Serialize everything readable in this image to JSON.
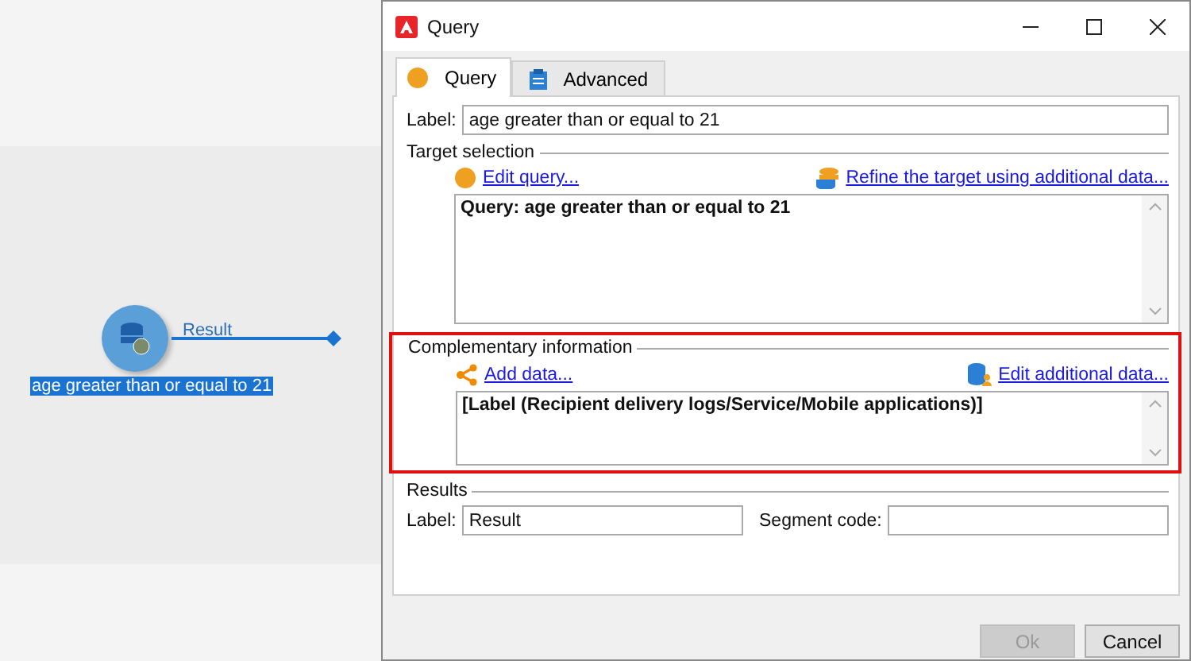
{
  "canvas": {
    "node": {
      "label": "age greater than or equal to 21",
      "selected": true
    },
    "transition": {
      "label": "Result"
    }
  },
  "window": {
    "title": "Query"
  },
  "tabs": [
    {
      "label": "Query",
      "selected": true
    },
    {
      "label": "Advanced",
      "selected": false
    }
  ],
  "label_field": {
    "label": "Label:",
    "value": "age greater than or equal to 21"
  },
  "target_selection": {
    "title": "Target selection",
    "links": [
      {
        "label": "Edit query..."
      },
      {
        "label": "Refine the target using additional data..."
      }
    ],
    "text": "Query: age greater than or equal to 21"
  },
  "complementary_information": {
    "title": "Complementary information",
    "highlighted": true,
    "links": [
      {
        "label": "Add data..."
      },
      {
        "label": "Edit additional data..."
      }
    ],
    "text": "[Label (Recipient delivery logs/Service/Mobile applications)]"
  },
  "results": {
    "title": "Results",
    "fields": [
      {
        "label": "Label:",
        "value": "Result"
      },
      {
        "label": "Segment code:"
      }
    ]
  },
  "buttons": [
    {
      "label": "Ok",
      "disabled": true
    },
    {
      "label": "Cancel",
      "disabled": false
    }
  ]
}
